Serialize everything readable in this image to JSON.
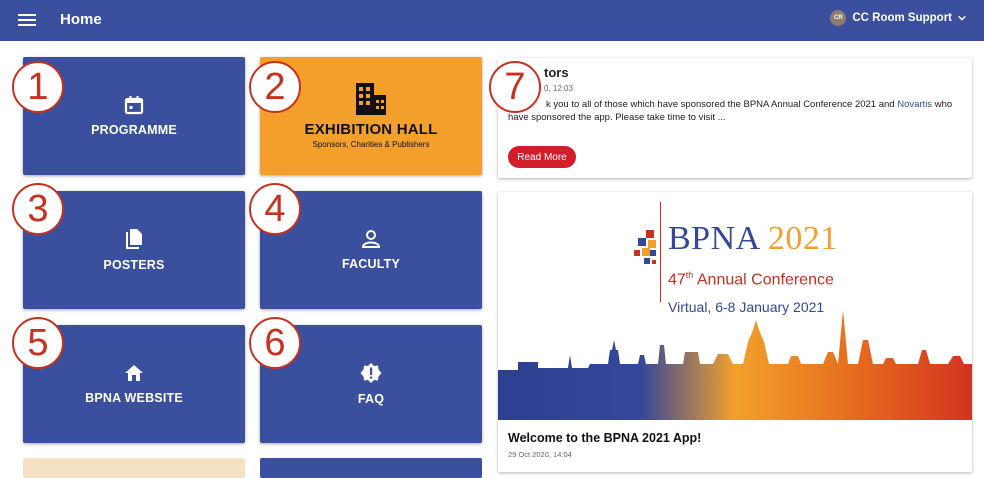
{
  "topbar": {
    "title": "Home",
    "user_initials": "CR",
    "user_name": "CC Room Support"
  },
  "tiles": [
    {
      "label": "PROGRAMME",
      "icon": "calendar-icon",
      "badge": "1"
    },
    {
      "label": "EXHIBITION HALL",
      "sublabel": "Sponsors, Charities & Publishers",
      "icon": "building-icon",
      "badge": "2"
    },
    {
      "label": "POSTERS",
      "icon": "document-icon",
      "badge": "3"
    },
    {
      "label": "FACULTY",
      "icon": "person-icon",
      "badge": "4"
    },
    {
      "label": "BPNA WEBSITE",
      "icon": "home-icon",
      "badge": "5"
    },
    {
      "label": "FAQ",
      "icon": "alert-badge-icon",
      "badge": "6"
    }
  ],
  "news": {
    "badge": "7",
    "title": "tors",
    "date": "0, 12:03",
    "body_pre": "k you to all of those which have sponsored the BPNA Annual Conference 2021 and ",
    "body_link": "Novartis",
    "body_post": " who have sponsored the app. Please take time to visit ...",
    "read_more": "Read More"
  },
  "banner": {
    "title_main": "BPNA",
    "title_year": "2021",
    "conf_number": "47",
    "conf_sup": "th",
    "conf_text": " Annual Conference",
    "virtual": "Virtual, 6-8 January 2021"
  },
  "welcome": {
    "title": "Welcome to the BPNA 2021 App!",
    "date": "29 Oct 2020, 14:04"
  },
  "colors": {
    "primary": "#3a4f9d",
    "orange": "#f2a02b",
    "red": "#c8301f",
    "button_red": "#d21e2b"
  }
}
